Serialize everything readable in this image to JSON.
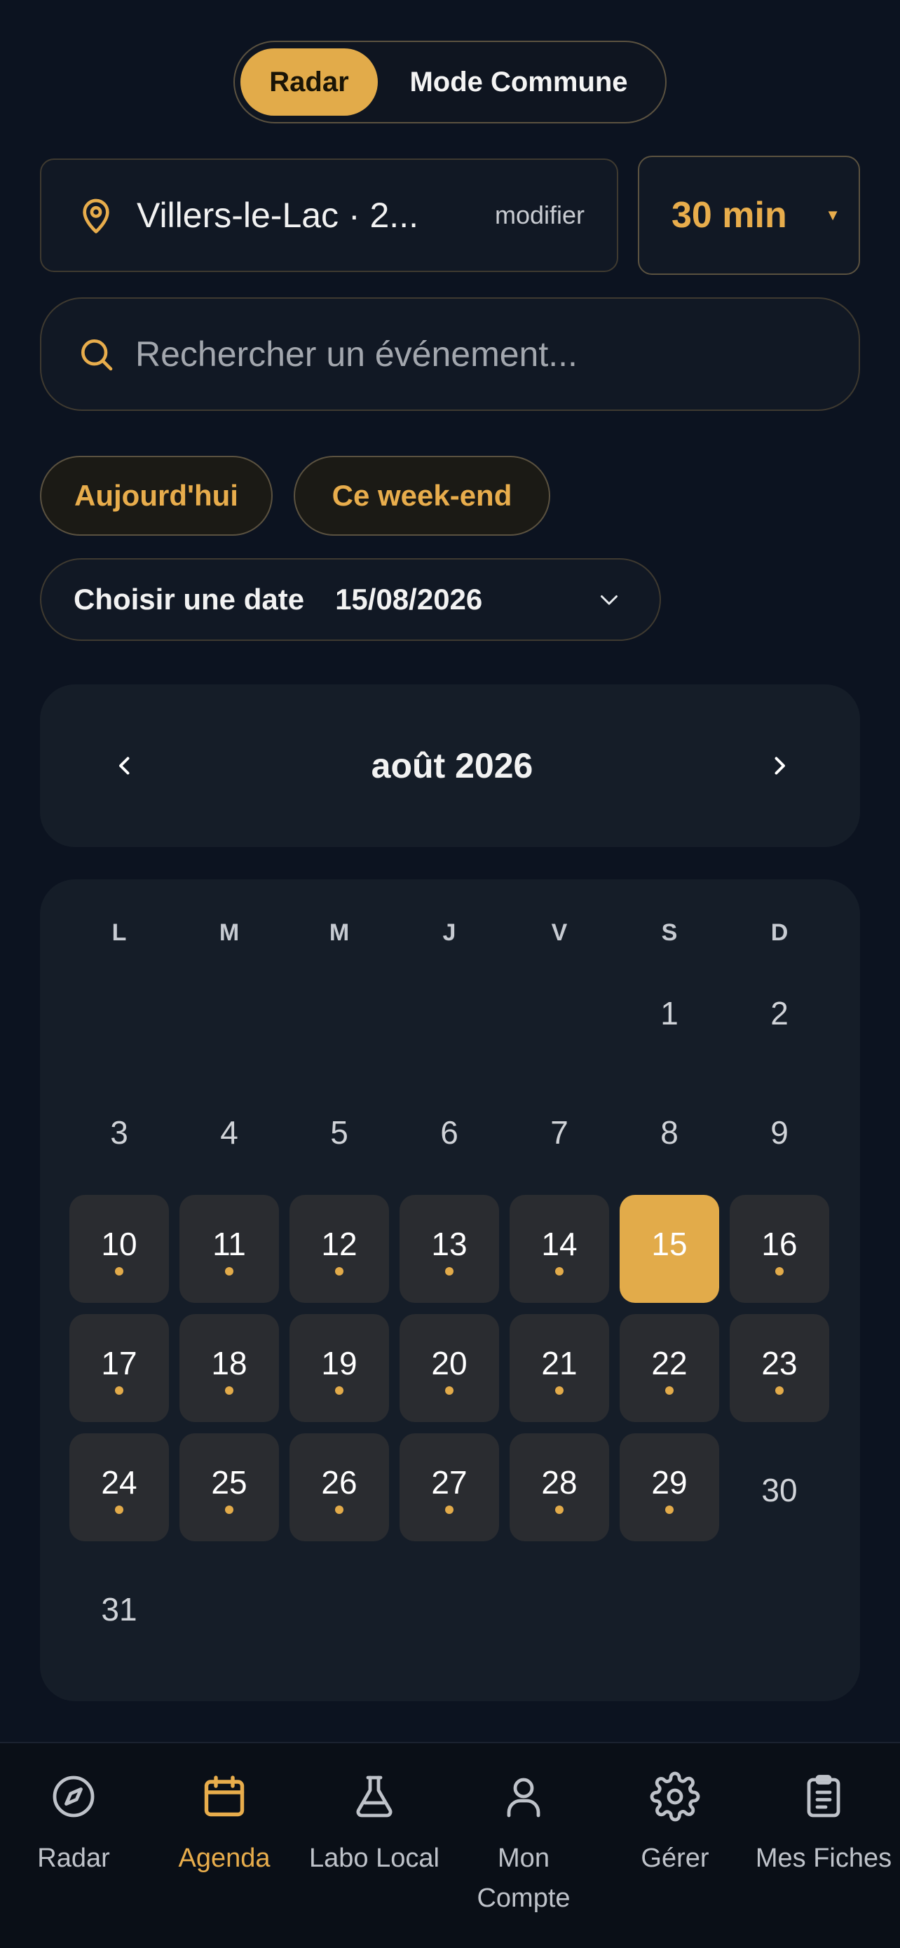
{
  "mode_toggle": {
    "radar_label": "Radar",
    "commune_label": "Mode Commune"
  },
  "location": {
    "text": "Villers-le-Lac · 2...",
    "modify_label": "modifier"
  },
  "radius": {
    "value": "30 min"
  },
  "search": {
    "placeholder": "Rechercher un événement..."
  },
  "quick_filters": {
    "today": "Aujourd'hui",
    "weekend": "Ce week-end"
  },
  "date_picker": {
    "label": "Choisir une date",
    "value": "15/08/2026"
  },
  "calendar": {
    "month_title": "août 2026",
    "weekdays": [
      "L",
      "M",
      "M",
      "J",
      "V",
      "S",
      "D"
    ],
    "selected_day": "15",
    "days": [
      {
        "d": "1",
        "ev": false
      },
      {
        "d": "2",
        "ev": false
      },
      {
        "d": "3",
        "ev": false
      },
      {
        "d": "4",
        "ev": false
      },
      {
        "d": "5",
        "ev": false
      },
      {
        "d": "6",
        "ev": false
      },
      {
        "d": "7",
        "ev": false
      },
      {
        "d": "8",
        "ev": false
      },
      {
        "d": "9",
        "ev": false
      },
      {
        "d": "10",
        "ev": true
      },
      {
        "d": "11",
        "ev": true
      },
      {
        "d": "12",
        "ev": true
      },
      {
        "d": "13",
        "ev": true
      },
      {
        "d": "14",
        "ev": true
      },
      {
        "d": "15",
        "ev": false
      },
      {
        "d": "16",
        "ev": true
      },
      {
        "d": "17",
        "ev": true
      },
      {
        "d": "18",
        "ev": true
      },
      {
        "d": "19",
        "ev": true
      },
      {
        "d": "20",
        "ev": true
      },
      {
        "d": "21",
        "ev": true
      },
      {
        "d": "22",
        "ev": true
      },
      {
        "d": "23",
        "ev": true
      },
      {
        "d": "24",
        "ev": true
      },
      {
        "d": "25",
        "ev": true
      },
      {
        "d": "26",
        "ev": true
      },
      {
        "d": "27",
        "ev": true
      },
      {
        "d": "28",
        "ev": true
      },
      {
        "d": "29",
        "ev": true
      },
      {
        "d": "30",
        "ev": false
      },
      {
        "d": "31",
        "ev": false
      }
    ]
  },
  "bottom_nav": {
    "radar": "Radar",
    "agenda": "Agenda",
    "labo": "Labo Local",
    "compte": "Mon\nCompte",
    "gerer": "Gérer",
    "fiches": "Mes Fiches"
  },
  "colors": {
    "accent": "#e2ab4a",
    "background": "#0c1320",
    "card": "#151d28"
  }
}
